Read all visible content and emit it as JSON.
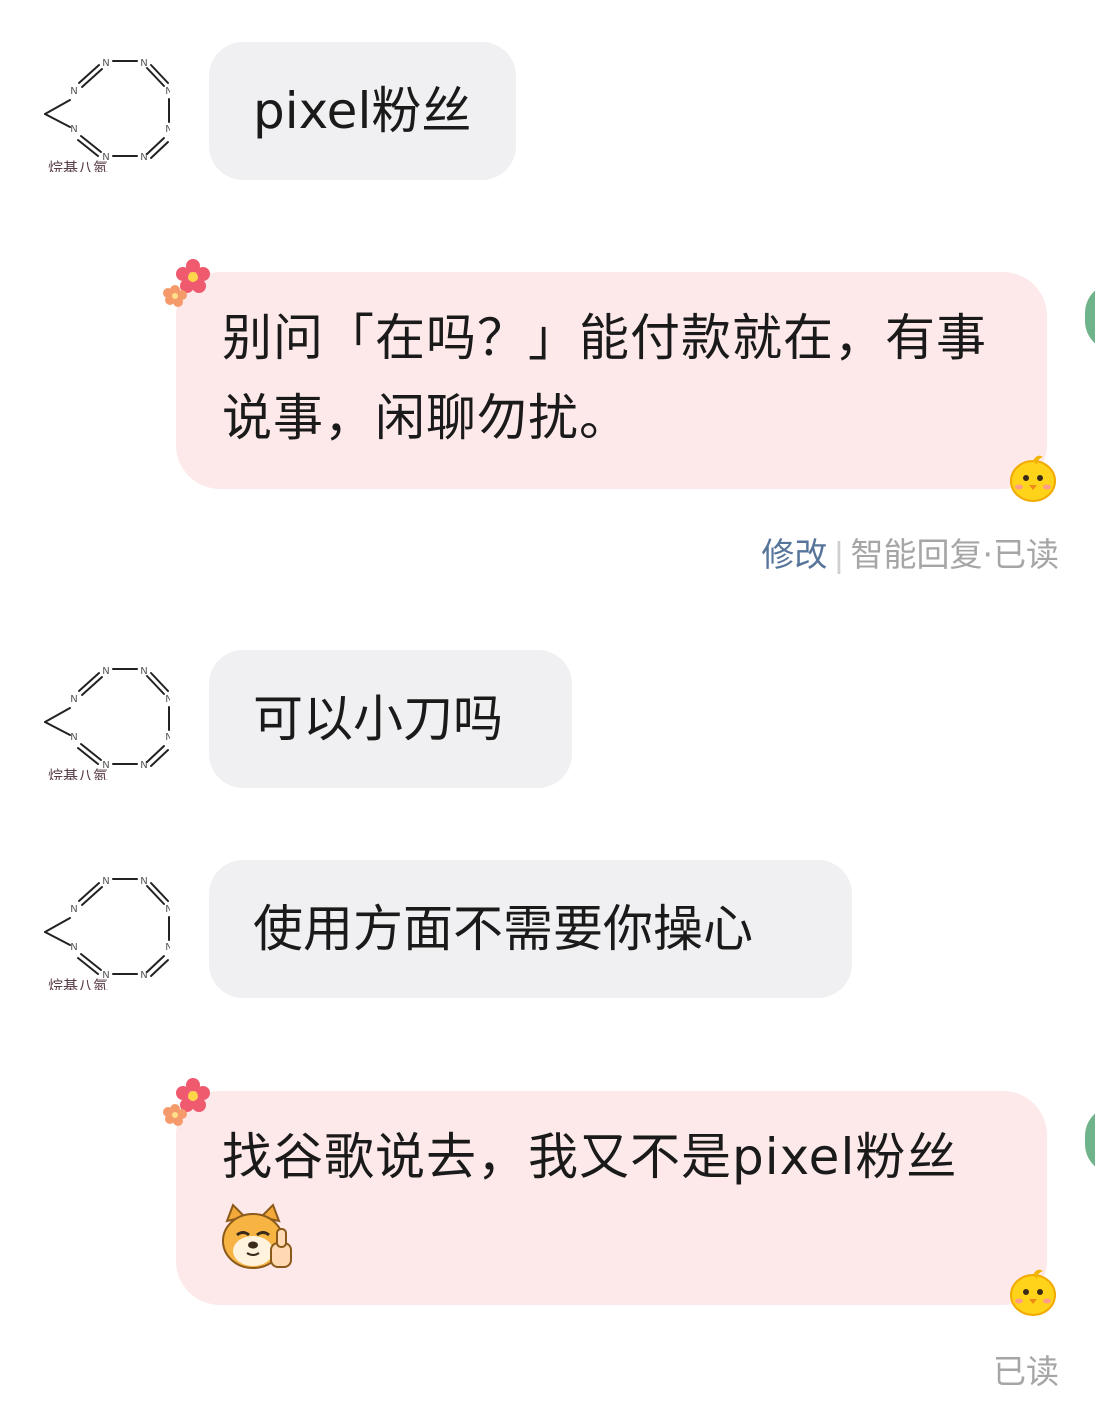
{
  "contact": {
    "avatar_caption": "烷基八氮",
    "avatar_atom_label": "N"
  },
  "messages": [
    {
      "direction": "incoming",
      "text": "pixel粉丝"
    },
    {
      "direction": "outgoing",
      "text": "别问「在吗？」能付款就在，有事说事，闲聊勿扰。",
      "actions": {
        "edit": "修改",
        "separator": "|",
        "status": "智能回复·已读"
      }
    },
    {
      "direction": "incoming",
      "text": "可以小刀吗"
    },
    {
      "direction": "incoming",
      "text": "使用方面不需要你操心"
    },
    {
      "direction": "outgoing",
      "text": "找谷歌说去，我又不是pixel粉丝",
      "emoji": "doge-thumbs-up",
      "status": "已读"
    }
  ],
  "decorations": {
    "bubble_corner_icon": "flower-icon",
    "bubble_tail_icon": "chick-icon"
  },
  "colors": {
    "incoming_bubble": "#f0f0f2",
    "outgoing_bubble": "#fde9ea",
    "edit_link": "#57759a",
    "status_text": "#a6a6a6",
    "edge_accent": "#6fb38a"
  }
}
